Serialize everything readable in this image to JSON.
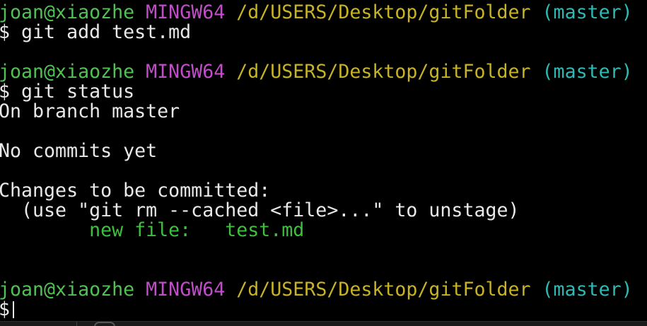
{
  "prompt": {
    "user_host": "joan@xiaozhe",
    "system": "MINGW64",
    "path": "/d/USERS/Desktop/gitFolder",
    "branch": "(master)",
    "symbol": "$"
  },
  "commands": {
    "add": "git add test.md",
    "status": "git status"
  },
  "status_output": {
    "branch_line": "On branch master",
    "commits_line": "No commits yet",
    "changes_header": "Changes to be committed:",
    "hint": "  (use \"git rm --cached <file>...\" to unstage)",
    "staged_entry": "        new file:   test.md"
  },
  "colors": {
    "background": "#000000",
    "user_host": "#52c154",
    "system": "#c04ec8",
    "path": "#c8b327",
    "branch": "#2fb9b5",
    "staged": "#3fbf3f",
    "text": "#e8e8e8"
  }
}
